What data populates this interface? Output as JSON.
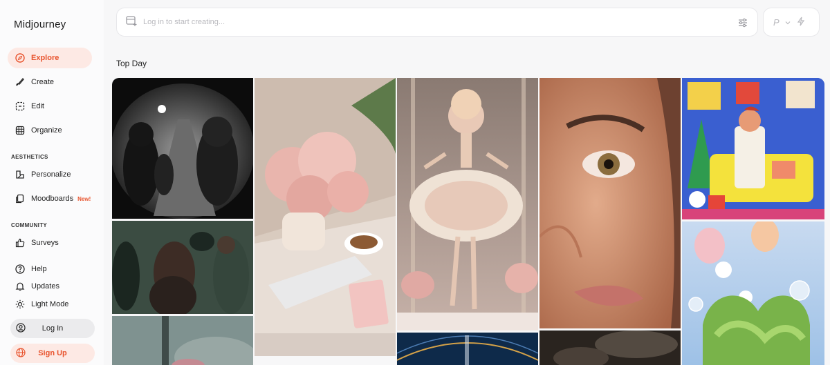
{
  "brand": "Midjourney",
  "nav": {
    "explore": "Explore",
    "create": "Create",
    "edit": "Edit",
    "organize": "Organize"
  },
  "aesthetics": {
    "label": "AESTHETICS",
    "personalize": "Personalize",
    "moodboards": "Moodboards",
    "moodboards_badge": "New!"
  },
  "community": {
    "label": "COMMUNITY",
    "surveys": "Surveys"
  },
  "footer_nav": {
    "help": "Help",
    "updates": "Updates",
    "light_mode": "Light Mode"
  },
  "auth": {
    "login": "Log In",
    "signup": "Sign Up"
  },
  "prompt": {
    "placeholder": "Log in to start creating..."
  },
  "mode": {
    "letter": "P"
  },
  "gallery": {
    "title": "Top Day"
  },
  "colors": {
    "accent": "#e8532d",
    "accent_bg": "#fde9e4"
  }
}
